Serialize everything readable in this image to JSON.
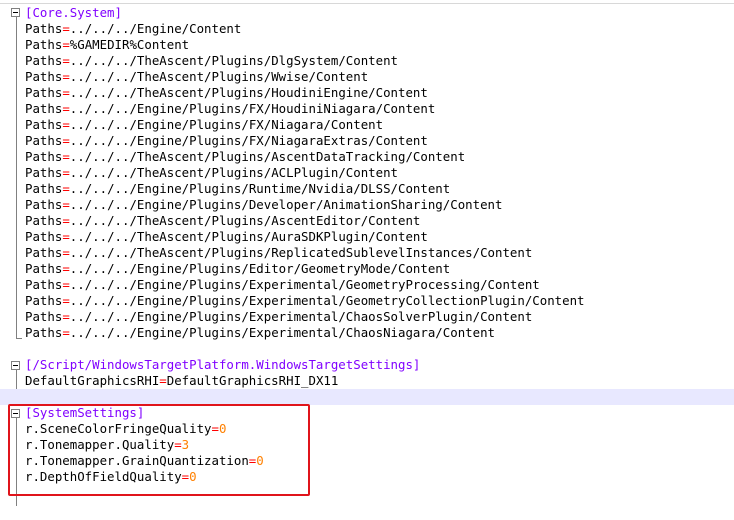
{
  "colors": {
    "section": "#8000ff",
    "key": "#000000",
    "equals": "#ff0000",
    "value": "#000000",
    "number": "#ff8000",
    "highlight": "#e8e8ff",
    "callout": "#e0141b"
  },
  "sections": [
    {
      "header": "[Core.System]",
      "lines": [
        {
          "key": "Paths",
          "value": "../../../Engine/Content"
        },
        {
          "key": "Paths",
          "value": "%GAMEDIR%Content"
        },
        {
          "key": "Paths",
          "value": "../../../TheAscent/Plugins/DlgSystem/Content"
        },
        {
          "key": "Paths",
          "value": "../../../TheAscent/Plugins/Wwise/Content"
        },
        {
          "key": "Paths",
          "value": "../../../TheAscent/Plugins/HoudiniEngine/Content"
        },
        {
          "key": "Paths",
          "value": "../../../Engine/Plugins/FX/HoudiniNiagara/Content"
        },
        {
          "key": "Paths",
          "value": "../../../Engine/Plugins/FX/Niagara/Content"
        },
        {
          "key": "Paths",
          "value": "../../../Engine/Plugins/FX/NiagaraExtras/Content"
        },
        {
          "key": "Paths",
          "value": "../../../TheAscent/Plugins/AscentDataTracking/Content"
        },
        {
          "key": "Paths",
          "value": "../../../TheAscent/Plugins/ACLPlugin/Content"
        },
        {
          "key": "Paths",
          "value": "../../../Engine/Plugins/Runtime/Nvidia/DLSS/Content"
        },
        {
          "key": "Paths",
          "value": "../../../Engine/Plugins/Developer/AnimationSharing/Content"
        },
        {
          "key": "Paths",
          "value": "../../../TheAscent/Plugins/AscentEditor/Content"
        },
        {
          "key": "Paths",
          "value": "../../../TheAscent/Plugins/AuraSDKPlugin/Content"
        },
        {
          "key": "Paths",
          "value": "../../../TheAscent/Plugins/ReplicatedSublevelInstances/Content"
        },
        {
          "key": "Paths",
          "value": "../../../Engine/Plugins/Editor/GeometryMode/Content"
        },
        {
          "key": "Paths",
          "value": "../../../Engine/Plugins/Experimental/GeometryProcessing/Content"
        },
        {
          "key": "Paths",
          "value": "../../../Engine/Plugins/Experimental/GeometryCollectionPlugin/Content"
        },
        {
          "key": "Paths",
          "value": "../../../Engine/Plugins/Experimental/ChaosSolverPlugin/Content"
        },
        {
          "key": "Paths",
          "value": "../../../Engine/Plugins/Experimental/ChaosNiagara/Content"
        }
      ]
    },
    {
      "header": "[/Script/WindowsTargetPlatform.WindowsTargetSettings]",
      "lines": [
        {
          "key": "DefaultGraphicsRHI",
          "value": "DefaultGraphicsRHI_DX11"
        }
      ]
    },
    {
      "header": "[SystemSettings]",
      "lines": [
        {
          "key": "r.SceneColorFringeQuality",
          "value": "0"
        },
        {
          "key": "r.Tonemapper.Quality",
          "value": "3"
        },
        {
          "key": "r.Tonemapper.GrainQuantization",
          "value": "0"
        },
        {
          "key": "r.DepthOfFieldQuality",
          "value": "0"
        }
      ]
    }
  ]
}
